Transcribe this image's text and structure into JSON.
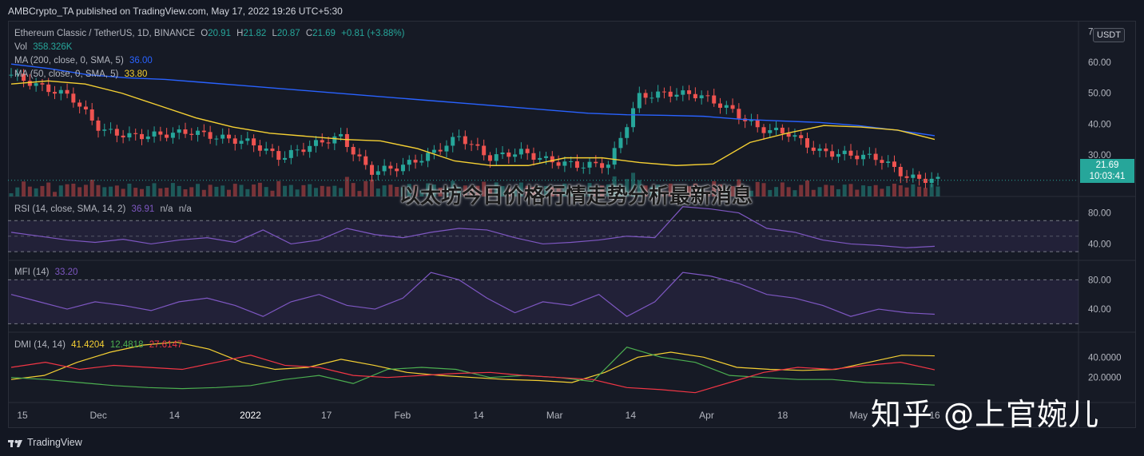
{
  "header": {
    "published": "AMBCrypto_TA published on TradingView.com, May 17, 2022 19:26 UTC+5:30"
  },
  "footer": {
    "brand": "TradingView"
  },
  "overlay": {
    "title": "以太坊今日价格行情走势分析最新消息",
    "watermark": "知乎 @上官婉儿"
  },
  "currency_button": "USDT",
  "last_price": {
    "price": "21.69",
    "countdown": "10:03:41"
  },
  "colors": {
    "up": "#26a69a",
    "down": "#ef5350",
    "ma200": "#2962ff",
    "ma50": "#f5d033",
    "rsi": "#7e57c2",
    "mfi": "#7e57c2",
    "adx": "#f5d033",
    "di_plus": "#4caf50",
    "di_minus": "#f23645"
  },
  "legend": {
    "symbol": "Ethereum Classic / TetherUS, 1D, BINANCE",
    "o_label": "O",
    "o": "20.91",
    "h_label": "H",
    "h": "21.82",
    "l_label": "L",
    "l": "20.87",
    "c_label": "C",
    "c": "21.69",
    "chg": "+0.81 (+3.88%)",
    "vol_label": "Vol",
    "vol": "358.326K",
    "ma200_label": "MA (200, close, 0, SMA, 5)",
    "ma200": "36.00",
    "ma50_label": "MA (50, close, 0, SMA, 5)",
    "ma50": "33.80",
    "rsi_label": "RSI (14, close, SMA, 14, 2)",
    "rsi": "36.91",
    "rsi_na1": "n/a",
    "rsi_na2": "n/a",
    "mfi_label": "MFI (14)",
    "mfi": "33.20",
    "dmi_label": "DMI (14, 14)",
    "adx": "41.4204",
    "di_plus": "12.4818",
    "di_minus": "27.6147"
  },
  "chart_data": [
    {
      "type": "line",
      "panel": "price",
      "x": [
        "15",
        "Dec",
        "14",
        "2022",
        "17",
        "Feb",
        "14",
        "Mar",
        "14",
        "Apr",
        "18",
        "May",
        "16"
      ],
      "y_ticks": [
        "70.00",
        "60.00",
        "50.00",
        "40.00",
        "30.00"
      ],
      "ylim": [
        18,
        72
      ],
      "series": [
        {
          "name": "MA (200, close, 0, SMA, 5)",
          "values": [
            59.5,
            58,
            56,
            55,
            54.5,
            53.5,
            52.5,
            51.5,
            50.5,
            49.5,
            48.5,
            47.5,
            46.5,
            45.5,
            44.5,
            43.5,
            43,
            42.8,
            42.5,
            41.5,
            41,
            40.5,
            39.5,
            38,
            36.2
          ]
        },
        {
          "name": "MA (50, close, 0, SMA, 5)",
          "values": [
            53,
            54,
            53,
            50,
            46,
            42,
            39,
            37,
            36,
            35,
            34.5,
            32,
            28,
            26.5,
            26.5,
            29,
            29,
            27.5,
            26.5,
            27,
            34,
            37,
            39.5,
            39,
            38,
            35
          ]
        },
        {
          "name": "close",
          "values": [
            56,
            52,
            49,
            38,
            36,
            36.5,
            37.5,
            35.5,
            34,
            29,
            33,
            36,
            24.5,
            26,
            30,
            36,
            29,
            31,
            28,
            26.5,
            27,
            49,
            50,
            49.5,
            45,
            38.5,
            37,
            31,
            30,
            29,
            22.5,
            21.7
          ]
        }
      ]
    },
    {
      "type": "line",
      "panel": "rsi",
      "y_ticks": [
        "80.00",
        "40.00"
      ],
      "ylim": [
        25,
        95
      ],
      "series": [
        {
          "name": "RSI (14, close, SMA, 14, 2)",
          "values": [
            55,
            50,
            45,
            42,
            46,
            40,
            45,
            48,
            42,
            58,
            40,
            45,
            60,
            52,
            48,
            55,
            60,
            58,
            48,
            40,
            42,
            45,
            50,
            48,
            88,
            85,
            80,
            60,
            55,
            45,
            40,
            38,
            35,
            37
          ]
        }
      ]
    },
    {
      "type": "line",
      "panel": "mfi",
      "y_ticks": [
        "80.00",
        "40.00"
      ],
      "ylim": [
        15,
        100
      ],
      "series": [
        {
          "name": "MFI (14)",
          "values": [
            60,
            50,
            40,
            50,
            45,
            38,
            50,
            55,
            45,
            30,
            50,
            60,
            45,
            40,
            55,
            90,
            80,
            55,
            35,
            50,
            45,
            60,
            30,
            50,
            90,
            85,
            75,
            60,
            55,
            45,
            30,
            40,
            35,
            33
          ]
        }
      ]
    },
    {
      "type": "line",
      "panel": "dmi",
      "y_ticks": [
        "40.0000",
        "20.0000"
      ],
      "ylim": [
        0,
        60
      ],
      "series": [
        {
          "name": "ADX",
          "values": [
            18,
            22,
            35,
            45,
            52,
            55,
            48,
            35,
            28,
            30,
            38,
            32,
            25,
            22,
            20,
            18,
            17,
            15,
            25,
            40,
            45,
            40,
            30,
            28,
            27,
            28,
            35,
            42,
            41.4
          ]
        },
        {
          "name": "+DI",
          "values": [
            20,
            18,
            15,
            12,
            10,
            9,
            10,
            12,
            18,
            22,
            14,
            28,
            30,
            28,
            20,
            22,
            20,
            16,
            50,
            40,
            35,
            22,
            20,
            18,
            18,
            15,
            14,
            12.5
          ]
        },
        {
          "name": "-DI",
          "values": [
            30,
            35,
            28,
            32,
            30,
            28,
            35,
            42,
            32,
            30,
            22,
            20,
            22,
            24,
            25,
            22,
            20,
            18,
            10,
            8,
            5,
            15,
            25,
            30,
            28,
            32,
            35,
            27.6
          ]
        }
      ]
    }
  ]
}
